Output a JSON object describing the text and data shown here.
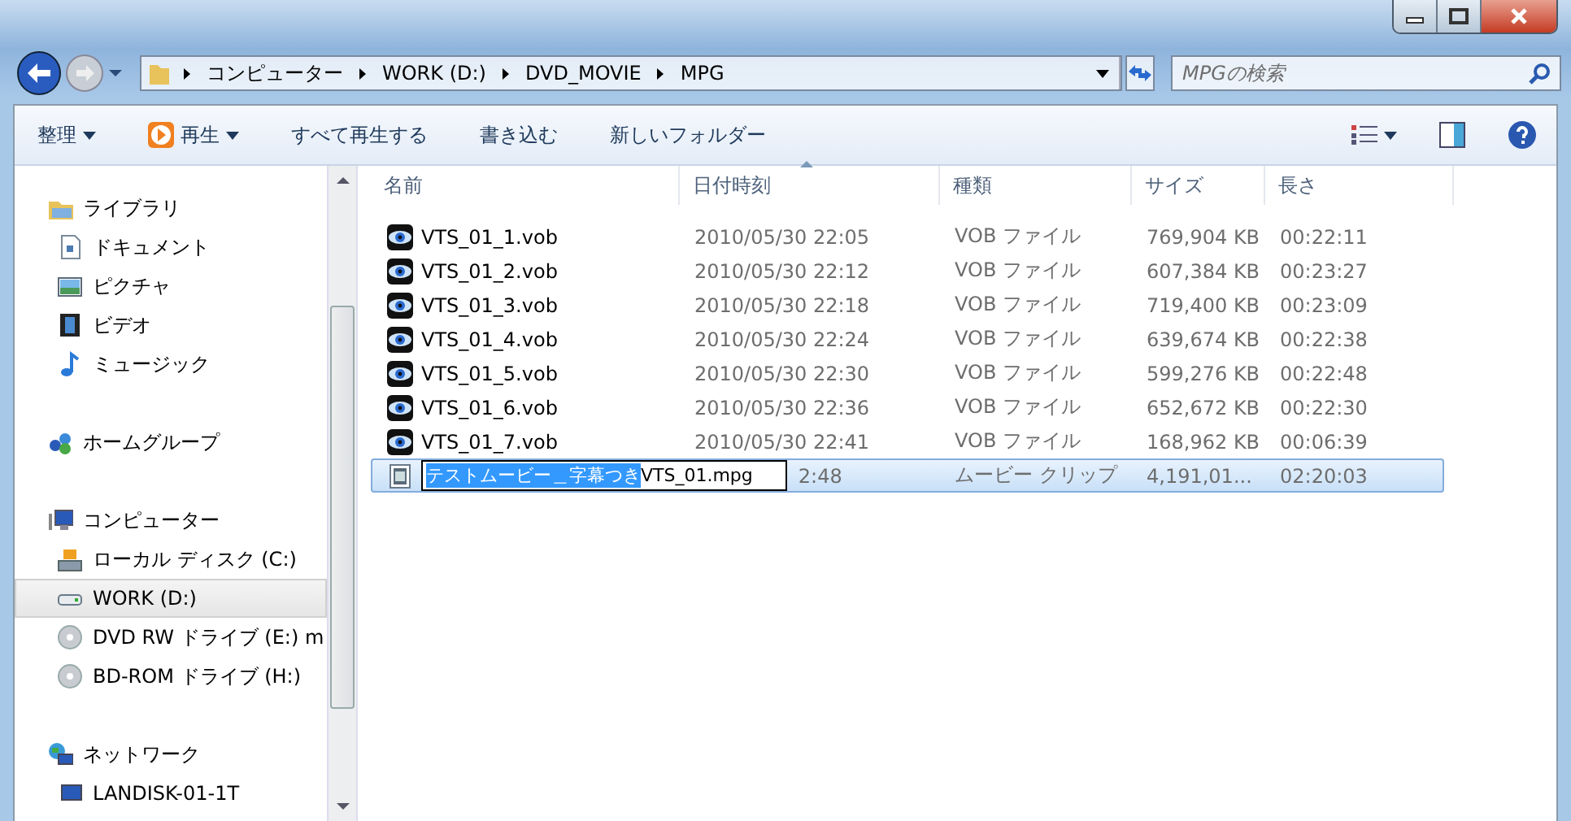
{
  "address": {
    "crumbs": [
      "コンピューター",
      "WORK (D:)",
      "DVD_MOVIE",
      "MPG"
    ]
  },
  "search": {
    "placeholder": "MPGの検索"
  },
  "toolbar": {
    "items": [
      {
        "label": "整理",
        "kind": "menu"
      },
      {
        "label": "再生",
        "kind": "play"
      },
      {
        "label": "すべて再生する",
        "kind": "plain"
      },
      {
        "label": "書き込む",
        "kind": "plain"
      },
      {
        "label": "新しいフォルダー",
        "kind": "plain"
      }
    ]
  },
  "nav": {
    "groups": [
      {
        "label": "ライブラリ",
        "kind": "library",
        "children": [
          {
            "label": "ドキュメント",
            "kind": "document",
            "selected": false
          },
          {
            "label": "ピクチャ",
            "kind": "picture",
            "selected": false
          },
          {
            "label": "ビデオ",
            "kind": "video",
            "selected": false
          },
          {
            "label": "ミュージック",
            "kind": "music",
            "selected": false
          }
        ]
      },
      {
        "label": "ホームグループ",
        "kind": "homegroup"
      },
      {
        "label": "コンピューター",
        "kind": "computer",
        "children": [
          {
            "label": "ローカル ディスク (C:)",
            "kind": "localdisk",
            "selected": false
          },
          {
            "label": "WORK (D:)",
            "kind": "drive",
            "selected": true
          },
          {
            "label": "DVD RW ドライブ (E:) m",
            "kind": "disc",
            "selected": false
          },
          {
            "label": "BD-ROM ドライブ (H:)",
            "kind": "disc",
            "selected": false
          }
        ]
      },
      {
        "label": "ネットワーク",
        "kind": "network",
        "children": [
          {
            "label": "LANDISK-01-1T",
            "kind": "netpc",
            "selected": false
          }
        ]
      }
    ]
  },
  "table": {
    "columns": [
      "名前",
      "日付時刻",
      "種類",
      "サイズ",
      "長さ"
    ],
    "rows": [
      {
        "kind": "vob",
        "name": "VTS_01_1.vob",
        "date": "2010/05/30 22:05",
        "type": "VOB ファイル",
        "size": "769,904 KB",
        "length": "00:22:11",
        "selected": false
      },
      {
        "kind": "vob",
        "name": "VTS_01_2.vob",
        "date": "2010/05/30 22:12",
        "type": "VOB ファイル",
        "size": "607,384 KB",
        "length": "00:23:27",
        "selected": false
      },
      {
        "kind": "vob",
        "name": "VTS_01_3.vob",
        "date": "2010/05/30 22:18",
        "type": "VOB ファイル",
        "size": "719,400 KB",
        "length": "00:23:09",
        "selected": false
      },
      {
        "kind": "vob",
        "name": "VTS_01_4.vob",
        "date": "2010/05/30 22:24",
        "type": "VOB ファイル",
        "size": "639,674 KB",
        "length": "00:22:38",
        "selected": false
      },
      {
        "kind": "vob",
        "name": "VTS_01_5.vob",
        "date": "2010/05/30 22:30",
        "type": "VOB ファイル",
        "size": "599,276 KB",
        "length": "00:22:48",
        "selected": false
      },
      {
        "kind": "vob",
        "name": "VTS_01_6.vob",
        "date": "2010/05/30 22:36",
        "type": "VOB ファイル",
        "size": "652,672 KB",
        "length": "00:22:30",
        "selected": false
      },
      {
        "kind": "vob",
        "name": "VTS_01_7.vob",
        "date": "2010/05/30 22:41",
        "type": "VOB ファイル",
        "size": "168,962 KB",
        "length": "00:06:39",
        "selected": false
      },
      {
        "kind": "movie",
        "rename": {
          "selected_text": "テストムービー＿字幕つき",
          "rest_text": "VTS_01.mpg"
        },
        "date": "2:48",
        "type": "ムービー クリップ",
        "size": "4,191,01...",
        "length": "02:20:03",
        "selected": true
      }
    ]
  }
}
